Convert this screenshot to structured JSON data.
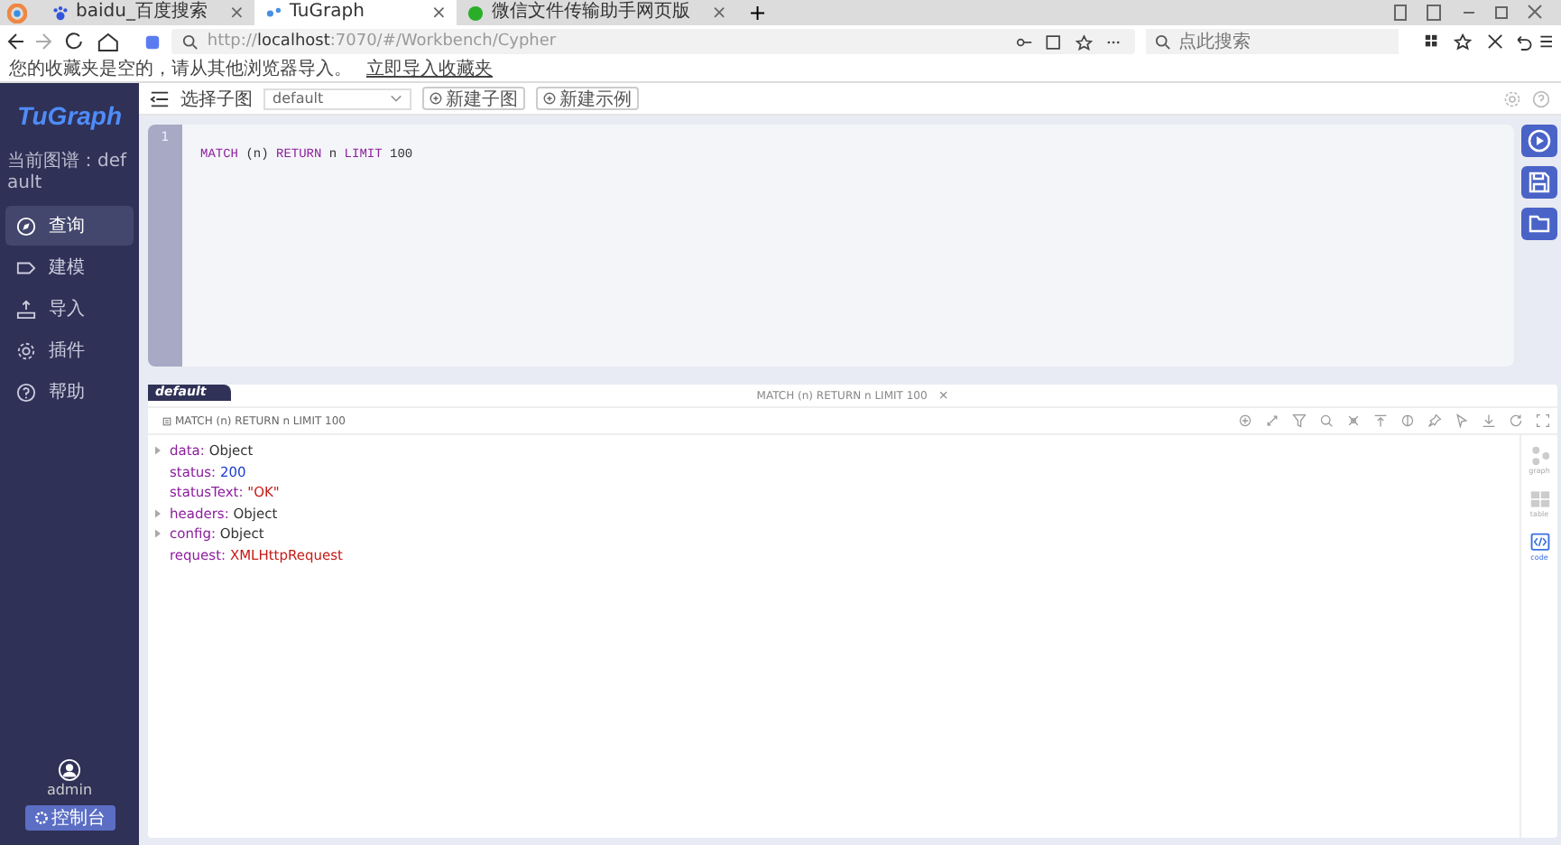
{
  "browser": {
    "tabs": [
      {
        "title": "baidu_百度搜索",
        "selected": false,
        "kind": "paw",
        "close": "×"
      },
      {
        "title": "TuGraph",
        "selected": true,
        "kind": "graph",
        "close": "×"
      },
      {
        "title": "微信文件传输助手网页版",
        "selected": false,
        "kind": "chat",
        "close": "×"
      }
    ],
    "new_tab": "+",
    "url_prefix": "http://",
    "url_host": "localhost",
    "url_rest": ":7070/#/Workbench/Cypher",
    "search": {
      "placeholder": "点此搜索"
    },
    "bookmarks_notice": {
      "text": "您的收藏夹是空的，请从其他浏览器导入。",
      "link": "立即导入收藏夹"
    }
  },
  "sidebar": {
    "logo": "TuGraph",
    "graph_label": "当前图谱：default",
    "items": [
      {
        "label": "查询",
        "selected": true,
        "kind": "query"
      },
      {
        "label": "建模",
        "selected": false,
        "kind": "model"
      },
      {
        "label": "导入",
        "selected": false,
        "kind": "import"
      },
      {
        "label": "插件",
        "selected": false,
        "kind": "plugin"
      },
      {
        "label": "帮助",
        "selected": false,
        "kind": "help"
      }
    ],
    "user": "admin",
    "console_button": "控制台"
  },
  "toolbar": {
    "label": "选择子图",
    "select": "default",
    "buttons": [
      "新建子图",
      "新建示例"
    ]
  },
  "editor": {
    "line_numbers": [
      "1"
    ],
    "tokens": [
      {
        "text": "MATCH",
        "kind": "keyword"
      },
      {
        "text": "(n)",
        "kind": "plain"
      },
      {
        "text": "RETURN",
        "kind": "keyword"
      },
      {
        "text": "n",
        "kind": "plain"
      },
      {
        "text": "LIMIT",
        "kind": "keyword"
      },
      {
        "text": "100",
        "kind": "plain"
      }
    ]
  },
  "result": {
    "graph_tab": "default",
    "title": "MATCH (n) RETURN n LIMIT 100",
    "close": "×",
    "query": "MATCH (n) RETURN n LIMIT 100",
    "rows": [
      {
        "key": "data:",
        "value": "Object",
        "kind": "object",
        "expandable": true
      },
      {
        "key": "status:",
        "value": "200",
        "kind": "number",
        "expandable": false
      },
      {
        "key": "statusText:",
        "value": "\"OK\"",
        "kind": "string",
        "expandable": false
      },
      {
        "key": "headers:",
        "value": "Object",
        "kind": "object",
        "expandable": true
      },
      {
        "key": "config:",
        "value": "Object",
        "kind": "object",
        "expandable": true
      },
      {
        "key": "request:",
        "value": "XMLHttpRequest",
        "kind": "string",
        "expandable": false
      }
    ],
    "views": [
      {
        "label": "graph",
        "selected": false,
        "kind": "graph"
      },
      {
        "label": "table",
        "selected": false,
        "kind": "table"
      },
      {
        "label": "code",
        "selected": true,
        "kind": "code"
      }
    ]
  }
}
